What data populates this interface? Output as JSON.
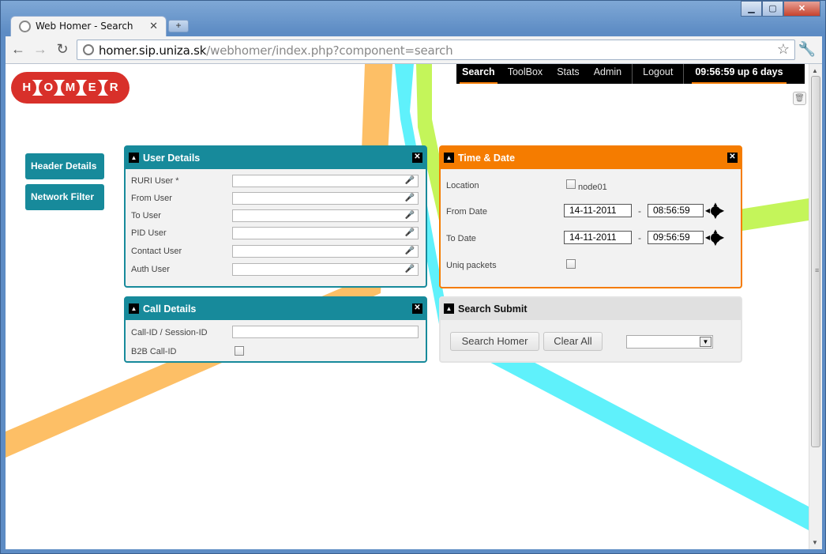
{
  "browser": {
    "tab_title": "Web Homer - Search",
    "new_tab_label": "+",
    "url_host": "homer.sip.uniza.sk",
    "url_path": "/webhomer/index.php?component=search"
  },
  "logo": {
    "letters": [
      "H",
      "O",
      "M",
      "E",
      "R"
    ]
  },
  "topnav": {
    "items": [
      "Search",
      "ToolBox",
      "Stats",
      "Admin"
    ],
    "logout": "Logout",
    "clock": "09:56:59 up 6 days"
  },
  "sidebar": {
    "header_details": "Header Details",
    "network_filter": "Network Filter"
  },
  "user_details": {
    "title": "User Details",
    "fields": [
      "RURI User *",
      "From User",
      "To User",
      "PID User",
      "Contact User",
      "Auth User"
    ]
  },
  "call_details": {
    "title": "Call Details",
    "call_id_label": "Call-ID / Session-ID",
    "b2b_label": "B2B Call-ID"
  },
  "time_date": {
    "title": "Time & Date",
    "location_label": "Location",
    "location_option": "node01",
    "from_label": "From Date",
    "from_date": "14-11-2011",
    "from_time": "08:56:59",
    "to_label": "To Date",
    "to_date": "14-11-2011",
    "to_time": "09:56:59",
    "uniq_label": "Uniq packets",
    "separator": "-"
  },
  "search_submit": {
    "title": "Search Submit",
    "search_button": "Search Homer",
    "clear_button": "Clear All",
    "select_value": ""
  },
  "colors": {
    "teal": "#178a9b",
    "orange": "#f57c00",
    "logo_red": "#d8302a"
  }
}
